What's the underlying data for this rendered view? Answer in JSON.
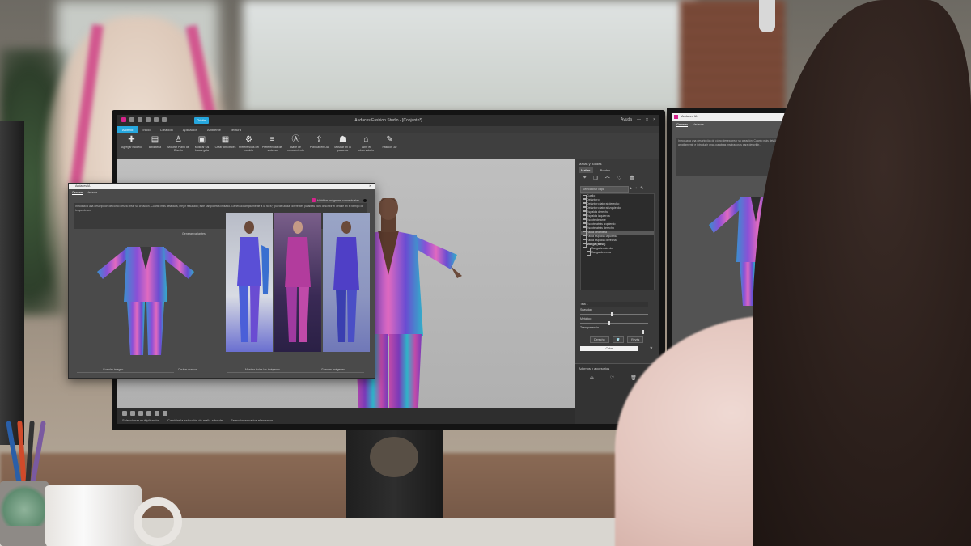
{
  "app": {
    "title": "Audaces Fashion Studio - [Conjunto*]",
    "orbit_button": "Orbital",
    "window_controls": [
      "Ayuda",
      "—",
      "□",
      "×"
    ],
    "menus": [
      "Archivo",
      "Inicio",
      "Creación",
      "Aplicación",
      "Ambiente",
      "Textura"
    ],
    "active_menu": "Archivo"
  },
  "ribbon": {
    "buttons": [
      {
        "icon": "plus-icon",
        "label": "Agregar modelo"
      },
      {
        "icon": "library-icon",
        "label": "Biblioteca"
      },
      {
        "icon": "mannequin-icon",
        "label": "Mostrar Plano de Diseño"
      },
      {
        "icon": "pattern-icon",
        "label": "Mostrar tus bases gala"
      },
      {
        "icon": "create-icon",
        "label": "Crear directrices"
      },
      {
        "icon": "settings-icon",
        "label": "Preferencias del modelo"
      },
      {
        "icon": "system-icon",
        "label": "Preferencias del sistema"
      },
      {
        "icon": "knowledge-icon",
        "label": "Base de conocimiento"
      },
      {
        "icon": "publish-icon",
        "label": "Publicar en OA"
      },
      {
        "icon": "show-icon",
        "label": "Mostrar en la pasarela"
      },
      {
        "icon": "observe-icon",
        "label": "Abrir el observatorio"
      },
      {
        "icon": "studio-icon",
        "label": "Fashion 3D"
      }
    ]
  },
  "status_bar": {
    "hint1": "Seleccionar multiplicación",
    "hint2": "Cambiar la selección de malla a borde",
    "hint3": "Seleccionar varios elementos"
  },
  "right_panel": {
    "title": "Mallas y Bordes",
    "tabs": [
      "Mallas",
      "Bordes"
    ],
    "active_tab": "Mallas",
    "layer_select": "Seleccionar capa",
    "pieces": [
      {
        "label": "Cuello",
        "type": "item"
      },
      {
        "label": "Delantero",
        "type": "item"
      },
      {
        "label": "Delantero lateral derecho",
        "type": "item"
      },
      {
        "label": "Delantero lateral izquierdo",
        "type": "item"
      },
      {
        "label": "Espalda derecha",
        "type": "item"
      },
      {
        "label": "Espalda izquierda",
        "type": "item"
      },
      {
        "label": "Escote delante",
        "type": "item"
      },
      {
        "label": "Escote atrás izquierdo",
        "type": "item"
      },
      {
        "label": "Escote atrás derecho",
        "type": "item"
      },
      {
        "label": "Falda delantera",
        "type": "sel"
      },
      {
        "label": "Falda espalda izquierda",
        "type": "item"
      },
      {
        "label": "Falda espalda derecha",
        "type": "item"
      },
      {
        "label": "Manga (Base)",
        "type": "grp"
      },
      {
        "label": "Manga izquierda",
        "type": "sub"
      },
      {
        "label": "Manga derecha",
        "type": "sub"
      }
    ],
    "material": "Tela 1",
    "sliders": [
      {
        "label": "Suavidad",
        "value": 0.45
      },
      {
        "label": "Metálico",
        "value": 0.4
      },
      {
        "label": "Transparencia",
        "value": 0.9
      }
    ],
    "buttons": [
      "Derecho",
      "Revés"
    ],
    "color_button": "Color",
    "adornos_title": "Adornos y accesorios"
  },
  "dialog": {
    "title": "Audaces IA",
    "tabs": [
      "Generar",
      "Variante"
    ],
    "active_tab": "Generar",
    "ai_toggle": "Habilitar imágenes conceptuales",
    "prompt": "Introduzca una descripción de cómo desea crear su creación. Cuanto más detallada, mejor resultado; este campo está limitado. Generado ampliamente a la hora y puede utilizar diferentes palabras para describir el detalle en el tiempo de lo que desee.",
    "generate_link": "Generar variantes",
    "footer": [
      "Guardar imagen",
      "Ocultar manual",
      "Mostrar todas las imágenes",
      "Guardar imágenes"
    ]
  },
  "second_window": {
    "title": "Audaces IA",
    "tabs": [
      "Generar",
      "Variante"
    ],
    "active_tab": "Generar",
    "prompt": "Introduzca una descripción de cómo desea crear su creación. Cuanto más detallada, mejor resultado. Generado ampliamente e introducir unas palabras inspiradoras para describir..."
  },
  "colors": {
    "accent": "#26a7de",
    "brand": "#d5238c",
    "suit_purple": "#8a4fd6",
    "suit_teal": "#2fb3c9",
    "suit_pink": "#c04aa9"
  }
}
